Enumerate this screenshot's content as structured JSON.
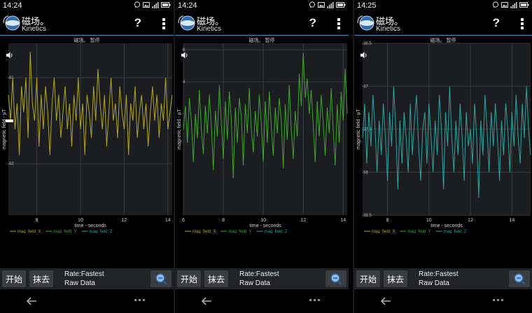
{
  "screens": [
    {
      "status_time": "14:24",
      "app_title": "磁场。",
      "app_subtitle": "Kinetics",
      "help_label": "?",
      "chart_title": "磁场。 暂停",
      "buttons": {
        "start": "开始",
        "erase": "抹去"
      },
      "rate_label": "Rate:Fastest",
      "mode_label": "Raw Data",
      "icons": [
        "chat-icon",
        "image-icon",
        "signal-icon",
        "battery-icon",
        "sound-icon",
        "zoom-icon",
        "back-icon",
        "more-icon"
      ]
    },
    {
      "status_time": "14:24",
      "app_title": "磁场。",
      "app_subtitle": "Kinetics",
      "help_label": "?",
      "chart_title": "磁场。 暂停",
      "buttons": {
        "start": "开始",
        "erase": "抹去"
      },
      "rate_label": "Rate:Fastest",
      "mode_label": "Raw Data"
    },
    {
      "status_time": "14:25",
      "app_title": "磁场。",
      "app_subtitle": "Kinetics",
      "help_label": "?",
      "chart_title": "磁场。 暂停",
      "buttons": {
        "start": "开始",
        "erase": "抹去"
      },
      "rate_label": "Rate:Fastest",
      "mode_label": "Raw Data"
    }
  ],
  "colors": {
    "mag_x": "#b3a51e",
    "mag_y": "#3fa52a",
    "mag_z": "#2aa5a0",
    "accent": "#3a8fbf",
    "grid": "#3a3a3a",
    "plot_bg": "#1b1d20"
  },
  "chart_data": [
    {
      "type": "line",
      "xlabel": "time - seconds",
      "ylabel": "magnetic field - μT",
      "xlim": [
        6.7,
        14.2
      ],
      "ylim": [
        -82.6,
        -80.6
      ],
      "x_ticks": [
        8,
        10,
        12,
        14
      ],
      "y_ticks": [
        "-81",
        "-82"
      ],
      "legend": [
        "mag_field_X",
        "mag_field_Y",
        "mag_field_Z"
      ],
      "grid": true,
      "series": [
        {
          "name": "mag_field_X",
          "color_key": "mag_x",
          "x": [
            6.7,
            6.8,
            6.9,
            7.0,
            7.1,
            7.2,
            7.3,
            7.4,
            7.5,
            7.6,
            7.7,
            7.8,
            7.9,
            8.0,
            8.1,
            8.2,
            8.3,
            8.4,
            8.5,
            8.6,
            8.7,
            8.8,
            8.9,
            9.0,
            9.1,
            9.2,
            9.3,
            9.4,
            9.5,
            9.6,
            9.7,
            9.8,
            9.9,
            10.0,
            10.1,
            10.2,
            10.3,
            10.4,
            10.5,
            10.6,
            10.7,
            10.8,
            10.9,
            11.0,
            11.1,
            11.2,
            11.3,
            11.4,
            11.5,
            11.6,
            11.7,
            11.8,
            11.9,
            12.0,
            12.1,
            12.2,
            12.3,
            12.4,
            12.5,
            12.6,
            12.7,
            12.8,
            12.9,
            13.0,
            13.1,
            13.2,
            13.3,
            13.4,
            13.5,
            13.6,
            13.7,
            13.8,
            13.9,
            14.0,
            14.1,
            14.2
          ],
          "y": [
            -81.2,
            -81.5,
            -81.0,
            -81.6,
            -81.3,
            -81.9,
            -81.1,
            -81.4,
            -81.0,
            -81.7,
            -80.7,
            -81.3,
            -81.5,
            -81.0,
            -81.8,
            -81.2,
            -81.6,
            -81.1,
            -81.4,
            -81.9,
            -81.3,
            -81.0,
            -81.5,
            -81.2,
            -81.7,
            -81.4,
            -81.1,
            -81.6,
            -81.3,
            -81.8,
            -81.2,
            -81.5,
            -81.0,
            -81.6,
            -81.3,
            -81.9,
            -81.2,
            -81.4,
            -81.7,
            -81.1,
            -81.5,
            -80.9,
            -81.3,
            -81.6,
            -81.2,
            -81.8,
            -81.4,
            -81.0,
            -81.5,
            -81.3,
            -81.7,
            -81.1,
            -81.4,
            -81.6,
            -81.2,
            -81.9,
            -81.3,
            -81.5,
            -81.1,
            -81.7,
            -81.4,
            -81.2,
            -81.6,
            -81.3,
            -81.8,
            -81.4,
            -81.1,
            -81.5,
            -81.2,
            -81.7,
            -81.3,
            -81.5,
            -81.0,
            -81.6,
            -81.4,
            -81.2
          ]
        }
      ]
    },
    {
      "type": "line",
      "xlabel": "time - seconds",
      "ylabel": "magnetic field - μT",
      "xlim": [
        6.0,
        14.2
      ],
      "ylim": [
        -4.3,
        6.4
      ],
      "x_ticks": [
        6,
        8,
        10,
        12,
        14
      ],
      "y_ticks": [
        "6",
        "4"
      ],
      "legend": [
        "mag_field_X",
        "mag_field_Y",
        "mag_field_Z"
      ],
      "grid": true,
      "series": [
        {
          "name": "mag_field_Y",
          "color_key": "mag_y",
          "x": [
            6.0,
            6.1,
            6.2,
            6.3,
            6.4,
            6.5,
            6.6,
            6.7,
            6.8,
            6.9,
            7.0,
            7.1,
            7.2,
            7.3,
            7.4,
            7.5,
            7.6,
            7.7,
            7.8,
            7.9,
            8.0,
            8.1,
            8.2,
            8.3,
            8.4,
            8.5,
            8.6,
            8.7,
            8.8,
            8.9,
            9.0,
            9.1,
            9.2,
            9.3,
            9.4,
            9.5,
            9.6,
            9.7,
            9.8,
            9.9,
            10.0,
            10.1,
            10.2,
            10.3,
            10.4,
            10.5,
            10.6,
            10.7,
            10.8,
            10.9,
            11.0,
            11.1,
            11.2,
            11.3,
            11.4,
            11.5,
            11.6,
            11.7,
            11.8,
            11.9,
            12.0,
            12.1,
            12.2,
            12.3,
            12.4,
            12.5,
            12.6,
            12.7,
            12.8,
            12.9,
            13.0,
            13.1,
            13.2,
            13.3,
            13.4,
            13.5,
            13.6,
            13.7,
            13.8,
            13.9,
            14.0,
            14.1,
            14.2
          ],
          "y": [
            1.0,
            2.5,
            0.2,
            3.0,
            1.5,
            -1.0,
            2.0,
            0.5,
            3.5,
            1.0,
            -0.5,
            2.5,
            0.8,
            3.2,
            1.2,
            -1.5,
            2.2,
            0.6,
            3.8,
            1.4,
            -0.8,
            2.8,
            0.4,
            3.4,
            1.6,
            -2.0,
            2.4,
            0.2,
            3.0,
            1.8,
            -1.2,
            2.6,
            0.8,
            3.6,
            1.0,
            -0.4,
            2.2,
            0.6,
            3.2,
            1.4,
            -1.0,
            2.8,
            0.2,
            3.4,
            1.2,
            -0.6,
            2.4,
            0.8,
            3.0,
            1.6,
            -1.4,
            2.6,
            0.4,
            3.8,
            1.0,
            -0.8,
            2.2,
            0.6,
            4.5,
            2.5,
            5.8,
            3.0,
            4.2,
            2.0,
            3.5,
            1.2,
            -1.0,
            2.8,
            0.6,
            3.2,
            1.4,
            -0.6,
            2.4,
            0.8,
            3.6,
            1.0,
            -1.2,
            2.6,
            0.2,
            3.4,
            1.6,
            4.8,
            2.0
          ]
        }
      ]
    },
    {
      "type": "line",
      "xlabel": "time - seconds",
      "ylabel": "magnetic field - μT",
      "xlim": [
        6.8,
        14.9
      ],
      "ylim": [
        -38.5,
        -36.5
      ],
      "x_ticks": [
        8,
        10,
        12,
        14
      ],
      "y_ticks": [
        "-36.5",
        "-37",
        "-37.5",
        "-38",
        "-38.5"
      ],
      "legend": [
        "mag_field_X",
        "mag_field_Y",
        "mag_field_Z"
      ],
      "grid": true,
      "series": [
        {
          "name": "mag_field_Z",
          "color_key": "mag_z",
          "x": [
            6.8,
            6.9,
            7.0,
            7.1,
            7.2,
            7.3,
            7.4,
            7.5,
            7.6,
            7.7,
            7.8,
            7.9,
            8.0,
            8.1,
            8.2,
            8.3,
            8.4,
            8.5,
            8.6,
            8.7,
            8.8,
            8.9,
            9.0,
            9.1,
            9.2,
            9.3,
            9.4,
            9.5,
            9.6,
            9.7,
            9.8,
            9.9,
            10.0,
            10.1,
            10.2,
            10.3,
            10.4,
            10.5,
            10.6,
            10.7,
            10.8,
            10.9,
            11.0,
            11.1,
            11.2,
            11.3,
            11.4,
            11.5,
            11.6,
            11.7,
            11.8,
            11.9,
            12.0,
            12.1,
            12.2,
            12.3,
            12.4,
            12.5,
            12.6,
            12.7,
            12.8,
            12.9,
            13.0,
            13.1,
            13.2,
            13.3,
            13.4,
            13.5,
            13.6,
            13.7,
            13.8,
            13.9,
            14.0,
            14.1,
            14.2,
            14.3,
            14.4,
            14.5,
            14.6,
            14.7,
            14.8,
            14.9
          ],
          "y": [
            -37.6,
            -37.2,
            -37.9,
            -37.3,
            -37.7,
            -37.1,
            -37.5,
            -38.0,
            -37.4,
            -37.8,
            -37.2,
            -37.6,
            -38.1,
            -37.3,
            -37.7,
            -37.0,
            -37.5,
            -38.2,
            -37.4,
            -37.9,
            -37.3,
            -37.6,
            -38.0,
            -37.2,
            -37.8,
            -37.4,
            -37.1,
            -37.7,
            -38.1,
            -37.5,
            -37.3,
            -37.9,
            -37.2,
            -37.6,
            -38.0,
            -37.4,
            -37.8,
            -37.1,
            -37.5,
            -38.2,
            -37.3,
            -37.7,
            -37.0,
            -37.6,
            -38.0,
            -37.4,
            -37.8,
            -37.2,
            -37.6,
            -38.1,
            -37.3,
            -37.7,
            -37.5,
            -37.9,
            -37.2,
            -37.6,
            -38.3,
            -37.4,
            -37.8,
            -37.1,
            -37.5,
            -38.0,
            -37.3,
            -37.7,
            -37.2,
            -37.6,
            -38.1,
            -37.4,
            -37.8,
            -37.2,
            -37.5,
            -38.0,
            -37.3,
            -37.7,
            -37.1,
            -37.6,
            -37.9,
            -37.2,
            -37.6,
            -37.0,
            -37.5,
            -37.8
          ]
        }
      ]
    }
  ]
}
